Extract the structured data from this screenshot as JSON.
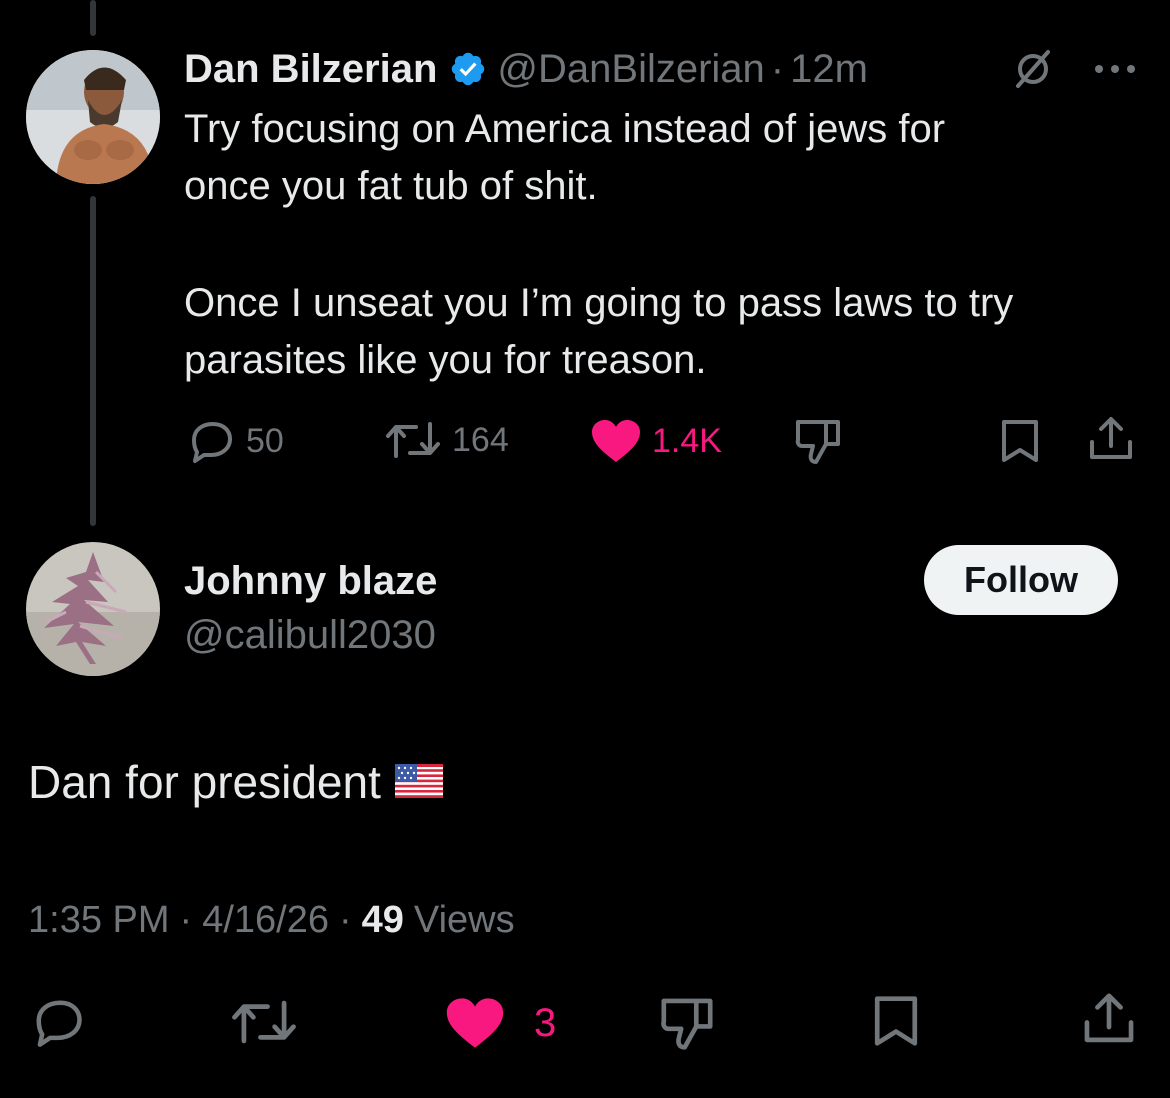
{
  "colors": {
    "background": "#000000",
    "text": "#e7e9ea",
    "muted": "#71767b",
    "like": "#f91880",
    "verified": "#1d9bf0",
    "thread_line": "#333639"
  },
  "parent_tweet": {
    "author_name": "Dan Bilzerian",
    "handle": "@DanBilzerian",
    "separator": "·",
    "time": "12m",
    "paragraph1": "Try focusing on America instead of jews for\nonce you fat tub of shit.",
    "paragraph2": "Once I unseat you I’m going to pass laws to try\nparasites like you for treason.",
    "stats": {
      "replies": "50",
      "reposts": "164",
      "likes": "1.4K"
    },
    "icons": [
      "grok-icon",
      "more-icon",
      "reply-icon",
      "repost-icon",
      "like-icon",
      "dislike-icon",
      "bookmark-icon",
      "share-icon"
    ]
  },
  "reply_tweet": {
    "author_name": "Johnny blaze",
    "handle": "@calibull2030",
    "follow_label": "Follow",
    "text": "Dan for president",
    "emoji": "us-flag-emoji",
    "time": "1:35 PM",
    "date": "4/16/26",
    "views_count": "49",
    "views_label": "Views",
    "dot": "·",
    "likes": "3"
  }
}
